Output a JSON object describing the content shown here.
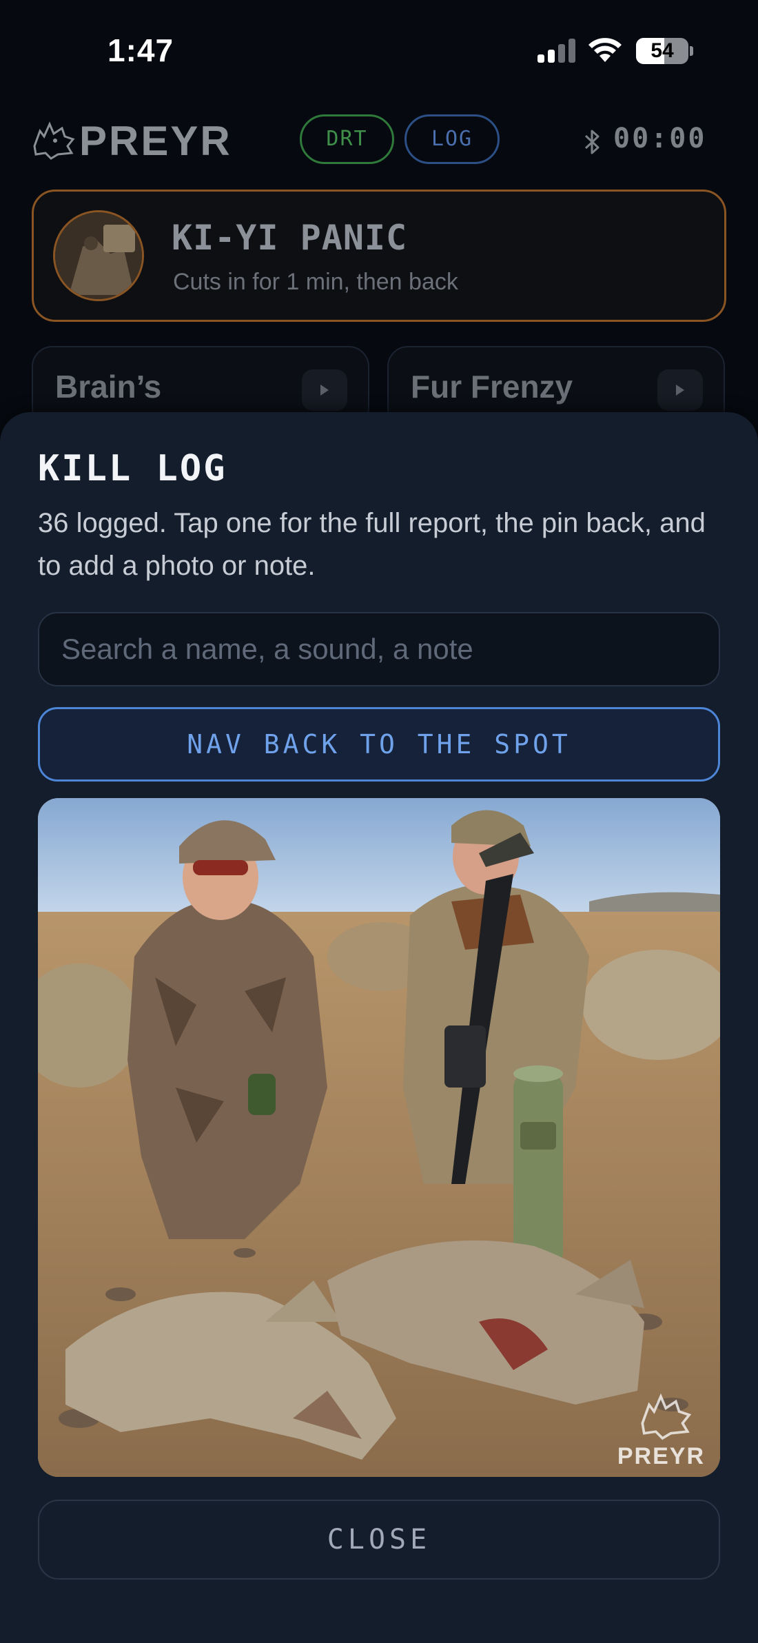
{
  "status_bar": {
    "time": "1:47",
    "battery_percent": 54,
    "battery_label": "54"
  },
  "header": {
    "logo_text": "PREYR",
    "mode_pills": [
      "DRT",
      "LOG"
    ],
    "timer": "00:00",
    "bluetooth_icon": "bluetooth-icon"
  },
  "now_playing": {
    "title": "KI-YI PANIC",
    "subtitle": "Cuts in for 1 min, then back",
    "accent_color": "#8a5523"
  },
  "sound_tiles": [
    {
      "label": "Brain’s"
    },
    {
      "label": "Fur Frenzy"
    }
  ],
  "kill_log": {
    "title": "KILL LOG",
    "description": "36 logged. Tap one for the full report, the pin back, and to add a photo or note.",
    "search_placeholder": "Search a name, a sound, a note",
    "nav_button": "NAV BACK TO THE SPOT",
    "photo_watermark": "PREYR",
    "close_button": "CLOSE",
    "accent_color": "#4d86d6"
  }
}
